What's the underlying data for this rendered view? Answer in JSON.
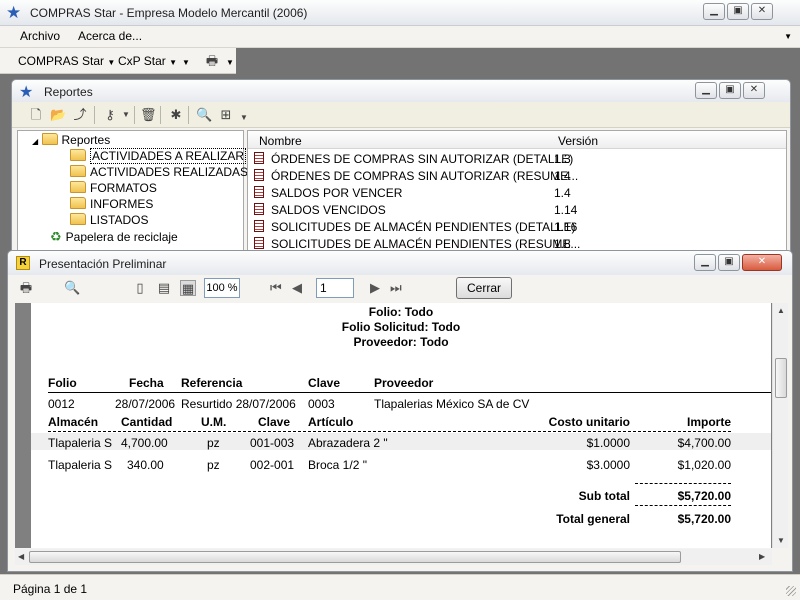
{
  "app": {
    "title": "COMPRAS Star - Empresa Modelo Mercantil (2006)",
    "menu": [
      "Archivo",
      "Acerca de..."
    ],
    "toolbar": [
      "COMPRAS Star",
      "CxP Star"
    ]
  },
  "reportes": {
    "title": "Reportes",
    "tree": {
      "root": "Reportes",
      "children": [
        "ACTIVIDADES A REALIZAR",
        "ACTIVIDADES REALIZADAS",
        "FORMATOS",
        "INFORMES",
        "LISTADOS"
      ],
      "recycle": "Papelera de reciclaje"
    },
    "columns": {
      "name": "Nombre",
      "version": "Versión"
    },
    "rows": [
      {
        "name": "ÓRDENES DE COMPRAS SIN AUTORIZAR (DETALLE)",
        "version": "1.3"
      },
      {
        "name": "ÓRDENES DE COMPRAS SIN AUTORIZAR (RESUME...",
        "version": "1.4"
      },
      {
        "name": "SALDOS POR VENCER",
        "version": "1.4"
      },
      {
        "name": "SALDOS VENCIDOS",
        "version": "1.14"
      },
      {
        "name": "SOLICITUDES DE ALMACÉN PENDIENTES (DETALLE)",
        "version": "1.16"
      },
      {
        "name": "SOLICITUDES DE ALMACÉN PENDIENTES (RESUME...",
        "version": "1.8"
      }
    ]
  },
  "preview": {
    "title": "Presentación Preliminar",
    "zoom": "100 %",
    "page": "1",
    "close_label": "Cerrar",
    "report": {
      "filters": [
        "Folio: Todo",
        "Folio Solicitud: Todo",
        "Proveedor: Todo"
      ],
      "header_cols": [
        "Folio",
        "Fecha",
        "Referencia",
        "Clave",
        "Proveedor"
      ],
      "header_row": {
        "folio": "0012",
        "fecha": "28/07/2006",
        "referencia": "Resurtido 28/07/2006",
        "clave": "0003",
        "proveedor": "Tlapalerias México SA de CV"
      },
      "detail_cols": [
        "Almacén",
        "Cantidad",
        "U.M.",
        "Clave",
        "Artículo",
        "Costo unitario",
        "Importe"
      ],
      "detail_rows": [
        {
          "almacen": "Tlapaleria S",
          "cantidad": "4,700.00",
          "um": "pz",
          "clave": "001-003",
          "articulo": "Abrazadera 2 \"",
          "costo": "$1.0000",
          "importe": "$4,700.00"
        },
        {
          "almacen": "Tlapaleria S",
          "cantidad": "340.00",
          "um": "pz",
          "clave": "002-001",
          "articulo": "Broca 1/2 \"",
          "costo": "$3.0000",
          "importe": "$1,020.00"
        }
      ],
      "subtotal_label": "Sub total",
      "subtotal": "$5,720.00",
      "total_label": "Total general",
      "total": "$5,720.00"
    }
  },
  "status": "Página 1 de 1"
}
